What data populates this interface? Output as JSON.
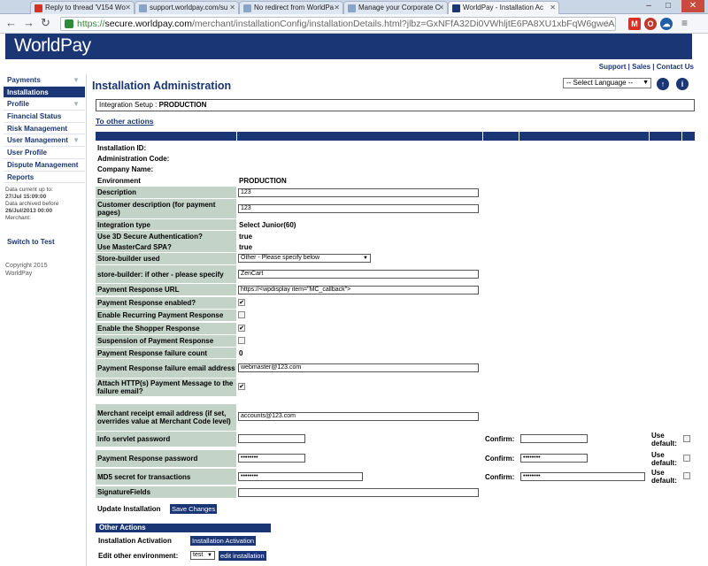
{
  "browser": {
    "tabs": [
      {
        "label": "Reply to thread 'V154 Wo",
        "color": "#d93025"
      },
      {
        "label": "support.worldpay.com/su",
        "color": "#8aa4c8"
      },
      {
        "label": "No redirect from WorldPa",
        "color": "#8aa4c8"
      },
      {
        "label": "Manage your Corporate C",
        "color": "#8aa4c8"
      },
      {
        "label": "WorldPay - Installation Ac",
        "color": "#1a3675"
      }
    ],
    "url_scheme": "https://",
    "url_host": "secure.worldpay.com",
    "url_path": "/merchant/installationConfig/installationDetails.html?jlbz=GxNFfA32Di0VWhljtE6PA8XU1xbFqW6gweAznp3bN"
  },
  "banner": {
    "logo": "WorldPay"
  },
  "toplinks": {
    "support": "Support",
    "sales": "Sales",
    "contact": "Contact Us",
    "sep": "|"
  },
  "sidebar": {
    "items": [
      {
        "label": "Payments",
        "expandable": true
      },
      {
        "label": "Installations",
        "active": true
      },
      {
        "label": "Profile",
        "expandable": true
      },
      {
        "label": "Financial Status"
      },
      {
        "label": "Risk Management"
      },
      {
        "label": "User Management",
        "expandable": true
      },
      {
        "label": "User Profile"
      },
      {
        "label": "Dispute Management"
      },
      {
        "label": "Reports"
      }
    ],
    "note1": "Data current up to:",
    "note2": "27/Jul 15:09:00",
    "note3": "Data archived before",
    "note4": "26/Jul/2013 00:00",
    "note5": "Merchant:",
    "switch": "Switch to Test",
    "copy1": "Copyright 2015",
    "copy2": "WorldPay"
  },
  "page": {
    "title": "Installation Administration",
    "language": "-- Select Language --",
    "env_label": "Integration Setup : ",
    "env_value": "PRODUCTION",
    "other_actions_link": "To other actions"
  },
  "info": {
    "installation_id": "Installation ID:",
    "admin_code": "Administration Code:",
    "company_name": "Company Name:",
    "environment": "Environment",
    "environment_value": "PRODUCTION"
  },
  "fields": {
    "description": {
      "label": "Description",
      "value": "123"
    },
    "customer_description": {
      "label": "Customer description (for payment pages)",
      "value": "123"
    },
    "integration_type": {
      "label": "Integration type",
      "value": "Select Junior(60)"
    },
    "use_3d": {
      "label": "Use 3D Secure Authentication?",
      "value": "true"
    },
    "use_mastercard": {
      "label": "Use MasterCard SPA?",
      "value": "true"
    },
    "store_builder": {
      "label": "Store-builder used",
      "value": "Other - Please specify below"
    },
    "store_builder_other": {
      "label": "store-builder: if other - please specify",
      "value": "ZenCart"
    },
    "payment_response_url": {
      "label": "Payment Response URL",
      "value": "https://<wpdisplay item=\"MC_callback\">"
    },
    "payment_response_enabled": {
      "label": "Payment Response enabled?",
      "checked": "✔"
    },
    "recurring_response": {
      "label": "Enable Recurring Payment Response",
      "checked": ""
    },
    "shopper_response": {
      "label": "Enable the Shopper Response",
      "checked": "✔"
    },
    "suspension": {
      "label": "Suspension of Payment Response",
      "checked": ""
    },
    "failure_count": {
      "label": "Payment Response failure count",
      "value": "0"
    },
    "failure_email": {
      "label": "Payment Response failure email address",
      "value": "webmaster@123.com"
    },
    "attach_http": {
      "label": "Attach HTTP(s) Payment Message to the failure email?",
      "checked": "✔"
    },
    "merchant_receipt": {
      "label": "Merchant receipt email address (if set, overrides value at Merchant Code level)",
      "value": "accounts@123.com"
    },
    "info_servlet": {
      "label": "Info servlet password",
      "value": "",
      "confirm": ""
    },
    "payment_response_password": {
      "label": "Payment Response password",
      "value": "••••••••",
      "confirm": "••••••••"
    },
    "md5_secret": {
      "label": "MD5 secret for transactions",
      "value": "••••••••",
      "confirm": "••••••••"
    },
    "signature_fields": {
      "label": "SignatureFields",
      "value": ""
    }
  },
  "labels": {
    "confirm": "Confirm:",
    "use_default": "Use default:"
  },
  "update": {
    "label": "Update Installation",
    "button": "Save Changes"
  },
  "other_actions": {
    "title": "Other Actions",
    "activation_label": "Installation Activation",
    "activation_button": "Installation Activation",
    "edit_label": "Edit other environment:",
    "edit_select": "test",
    "edit_button": "edit installation"
  }
}
